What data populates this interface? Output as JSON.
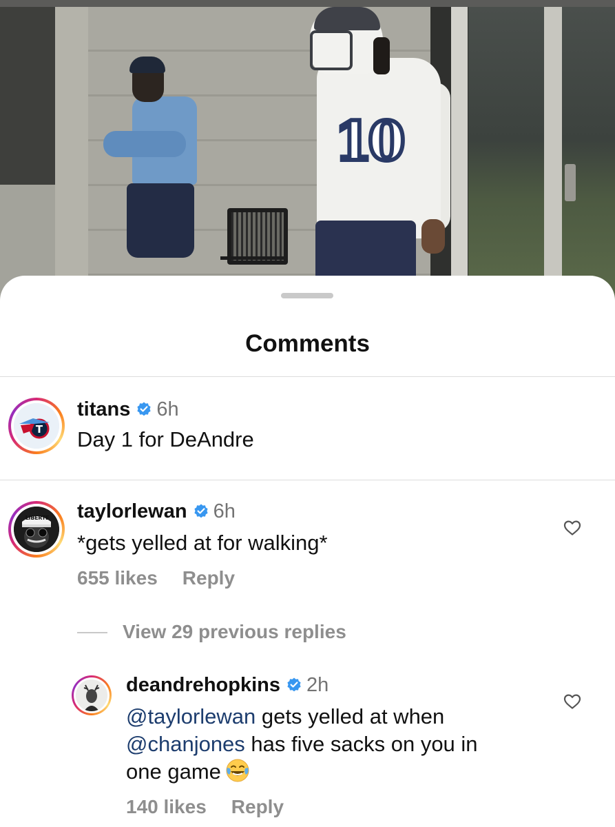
{
  "sheet": {
    "title": "Comments"
  },
  "comments": [
    {
      "username": "titans",
      "time": "6h",
      "text": "Day 1 for DeAndre",
      "avatar": "titans-logo"
    },
    {
      "username": "taylorlewan",
      "time": "6h",
      "text": "*gets yelled at for walking*",
      "likes": "655 likes",
      "reply": "Reply",
      "avatar": "taylorlewan-avatar",
      "avatar_cap_text": "LIBERTE"
    }
  ],
  "replies_toggle": "View 29 previous replies",
  "reply": {
    "username": "deandrehopkins",
    "time": "2h",
    "mention1": "@taylorlewan",
    "text1": " gets yelled at when",
    "mention2": "@chanjones",
    "text2": " has five sacks on you in",
    "text3": "one game",
    "emoji": "😂",
    "likes": "140 likes",
    "reply": "Reply",
    "avatar": "deandrehopkins-avatar"
  },
  "icons": {
    "verified": "verified-badge-icon",
    "heart": "heart-outline-icon"
  },
  "colors": {
    "verified": "#3897f0",
    "mention": "#1d3d6e",
    "secondary_text": "#8e8e8e"
  }
}
